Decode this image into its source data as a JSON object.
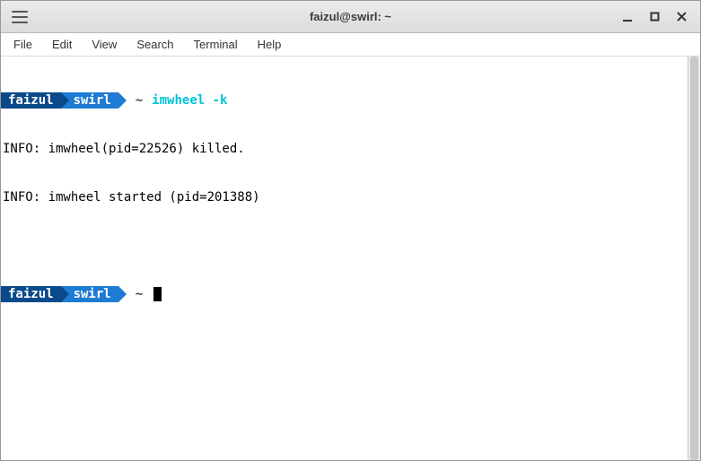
{
  "window": {
    "title": "faizul@swirl: ~"
  },
  "menubar": {
    "items": [
      "File",
      "Edit",
      "View",
      "Search",
      "Terminal",
      "Help"
    ]
  },
  "prompt": {
    "user": "faizul",
    "host": "swirl",
    "path": "~"
  },
  "session": {
    "command1": "imwheel -k",
    "output1": "INFO: imwheel(pid=22526) killed.",
    "output2": "INFO: imwheel started (pid=201388)"
  }
}
